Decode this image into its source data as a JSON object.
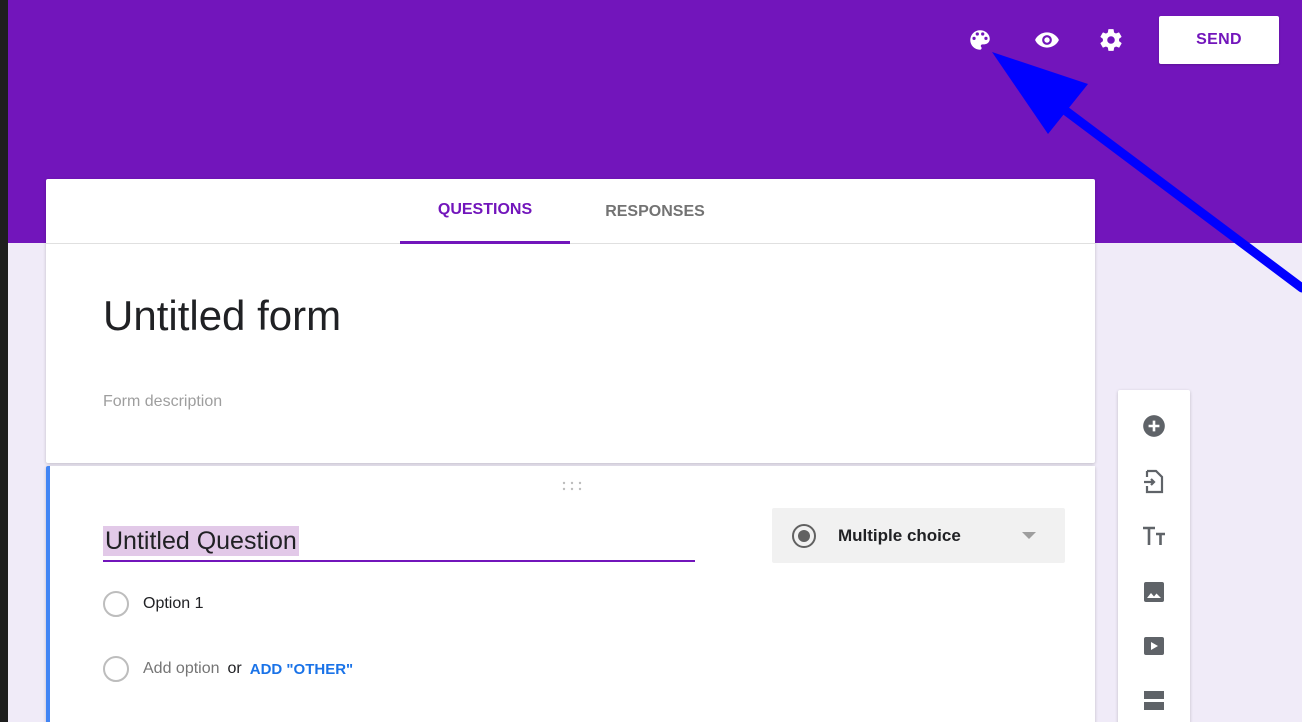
{
  "header": {
    "send_label": "SEND",
    "icons": [
      "palette-icon",
      "eye-icon",
      "gear-icon"
    ],
    "color": "#7215bb"
  },
  "tabs": [
    {
      "label": "QUESTIONS",
      "active": true
    },
    {
      "label": "RESPONSES",
      "active": false
    }
  ],
  "form": {
    "title": "Untitled form",
    "description_placeholder": "Form description"
  },
  "question": {
    "title": "Untitled Question",
    "type": "Multiple choice",
    "options": [
      "Option 1"
    ],
    "add_option": "Add option",
    "or_text": "or",
    "add_other": "ADD \"OTHER\""
  },
  "toolbar": {
    "icons": [
      "add-question-icon",
      "import-questions-icon",
      "title-text-icon",
      "image-icon",
      "video-icon",
      "section-icon"
    ]
  },
  "annotation": {
    "arrow_color": "#0000ff"
  }
}
